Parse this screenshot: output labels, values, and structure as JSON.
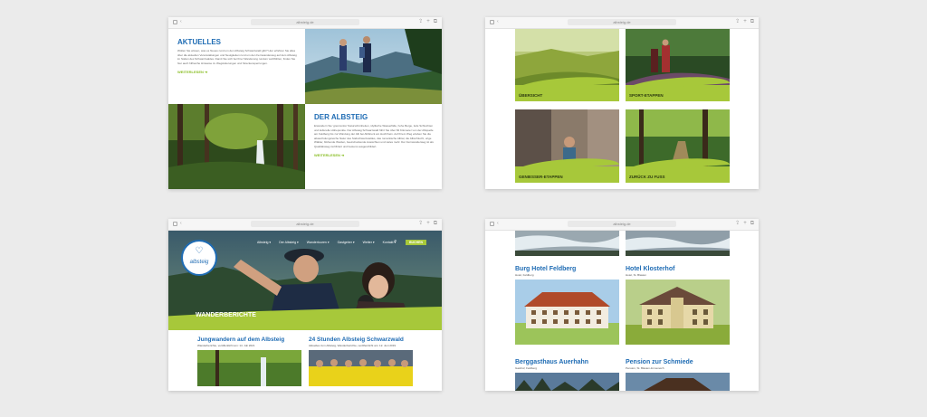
{
  "browser": {
    "url": "albsteig.de"
  },
  "win1": {
    "aktuelles_title": "AKTUELLES",
    "aktuelles_text": "Wollen Sie wissen, was es Neues rund um den Albsteig Schwarzwald gibt? Hier erfahren Sie alles über die aktuellen Veranstaltungen und Neuigkeiten rund um den Fernwanderweg auf dem Albsteig im Süden des Schwarzwaldes. Damit Sie sich bei Ihrer Wanderung rundum wohlfühlen, finden Sie hier auch hilfreiche Hinweise zu Wegänderungen und Streckensperrungen.",
    "aktuelles_more": "WEITERLESEN",
    "albsteig_title": "DER ALBSTEIG",
    "albsteig_text": "Erwandern Sie 'grenzenlos' Naturschönheiten, idyllische Wasserfälle, hohe Berge, tiefe Schluchten und kulturelle Höhepunkte. Der Albsteig Schwarzwald führt Sie über 84 Kilometer von der Albquelle am Feldberg bis zur Mündung der Alb bei Albbruck am Hochrhein. Auf Ihrem Weg erleben Sie die abwechslungsreiche Natur des Südschwarzwaldes, das romantische Albtal, die Albschlucht, urige Wälder, blühende Weiden, beeindruckende Aussichten und vieles mehr. Der Fernwanderweg ist als Qualitätsweg zertifiziert und bestens ausgeschildert.",
    "albsteig_more": "WEITERLESEN"
  },
  "win2": {
    "cards": [
      {
        "label": "ÜBERSICHT"
      },
      {
        "label": "SPORT-ETAPPEN"
      },
      {
        "label": "GENIESSER-ETAPPEN"
      },
      {
        "label": "ZURÜCK ZU FUSS"
      }
    ]
  },
  "win3": {
    "logo_text": "albsteig",
    "nav": [
      {
        "label": "Albsteig ▾"
      },
      {
        "label": "Der Albsteig ▾"
      },
      {
        "label": "Wandertouren ▾"
      },
      {
        "label": "Gastgeber ▾"
      },
      {
        "label": "Wetter ▾"
      },
      {
        "label": "Kontakt ▾"
      }
    ],
    "cta": "BUCHEN",
    "hero_title": "WANDERBERICHTE",
    "posts": [
      {
        "title": "Jungwandern auf dem Albsteig",
        "meta": "Wanderberichte, veröffentlicht am: 14. Juli 2021"
      },
      {
        "title": "24 Stunden Albsteig Schwarzwald",
        "meta": "Aktuelles zum Albsteig, Wanderberichte, veröffentlicht am: 12. Juni 2019"
      }
    ]
  },
  "win4": {
    "hotels": [
      {
        "name": "Burg Hotel Feldberg",
        "sub": "Hotel, Feldberg"
      },
      {
        "name": "Hotel Klosterhof",
        "sub": "Hotel, St. Blasien"
      },
      {
        "name": "Berggasthaus Auerhahn",
        "sub": "Gasthof, Feldberg"
      },
      {
        "name": "Pension zur Schmiede",
        "sub": "Pension, St. Blasien-Immeneich"
      }
    ]
  }
}
